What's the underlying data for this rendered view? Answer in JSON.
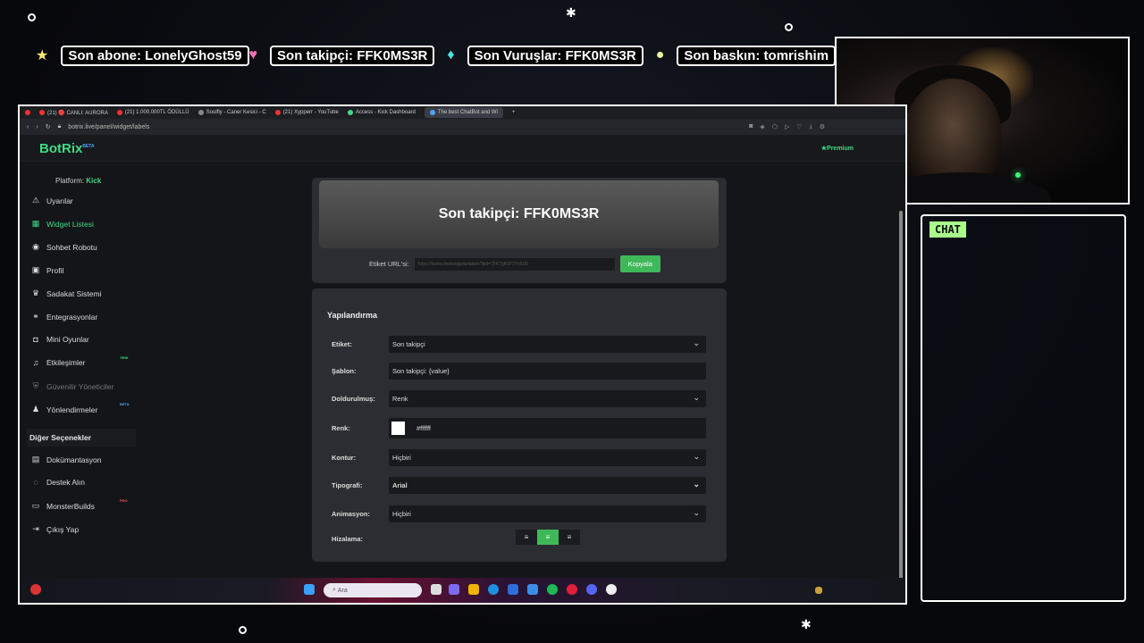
{
  "ticker": [
    {
      "icon": "star-icon",
      "text": "Son abone: LonelyGhost59"
    },
    {
      "icon": "heart-icon",
      "text": "Son takipçi: FFK0MS3R"
    },
    {
      "icon": "diamond-icon",
      "text": "Son Vuruşlar: FFK0MS3R"
    },
    {
      "icon": "moon-icon",
      "text": "Son baskın: tomrishim"
    }
  ],
  "chat": {
    "label": "CHAT"
  },
  "browser": {
    "tabs": [
      "(21) 🔴 CANLI: AURORA",
      "(21) 1.000.000TL ÖDÜLLÜ",
      "Soulfly - Caner Kesici - C",
      "(21) Xypperr - YouTube",
      "Access - Kick Dashboard",
      "The best ChatBot and Wi"
    ],
    "url": "botrix.live/panel/widget/labels"
  },
  "app": {
    "logo": "BotRix",
    "logo_badge": "BETA",
    "premium": "Premium",
    "platform_label": "Platform:",
    "platform_value": "Kick"
  },
  "sidebar": {
    "items": [
      {
        "icon": "warning-icon",
        "label": "Uyarılar"
      },
      {
        "icon": "grid-icon",
        "label": "Widget Listesi"
      },
      {
        "icon": "robot-icon",
        "label": "Sohbet Robotu"
      },
      {
        "icon": "user-icon",
        "label": "Profil"
      },
      {
        "icon": "trophy-icon",
        "label": "Sadakat Sistemi"
      },
      {
        "icon": "plug-icon",
        "label": "Entegrasyonlar"
      },
      {
        "icon": "gamepad-icon",
        "label": "Mini Oyunlar"
      },
      {
        "icon": "music-icon",
        "label": "Etkileşimler"
      },
      {
        "icon": "shield-icon",
        "label": "Güvenilir Yöneticiler"
      },
      {
        "icon": "users-icon",
        "label": "Yönlendirmeler"
      }
    ],
    "badges": {
      "new": "YENİ",
      "beta": "BETA"
    },
    "section_title": "Diğer Seçenekler",
    "other": [
      {
        "icon": "book-icon",
        "label": "Dokümantasyon"
      },
      {
        "icon": "help-icon",
        "label": "Destek Alın"
      },
      {
        "icon": "laptop-icon",
        "label": "MonsterBuilds"
      },
      {
        "icon": "logout-icon",
        "label": "Çıkış Yap"
      }
    ],
    "other_badge": "PRO"
  },
  "preview": {
    "text": "Son takipçi: FFK0MS3R",
    "url_label": "Etiket URL'si:",
    "url_value": "https://botrix.live/widgets/labels?bid=7FK7gK6F1Yn5U0",
    "copy_button": "Kopyala"
  },
  "config": {
    "title": "Yapılandırma",
    "fields": {
      "label": {
        "name": "Etiket:",
        "value": "Son takipçi"
      },
      "template": {
        "name": "Şablon:",
        "value": "Son takipçi: {value}"
      },
      "fill": {
        "name": "Doldurulmuş:",
        "value": "Renk"
      },
      "color": {
        "name": "Renk:",
        "value": "#ffffff"
      },
      "stroke": {
        "name": "Kontur:",
        "value": "Hiçbiri"
      },
      "typography": {
        "name": "Tipografi:",
        "value": "Arial"
      },
      "animation": {
        "name": "Animasyon:",
        "value": "Hiçbiri"
      },
      "alignment": {
        "name": "Hizalama:",
        "selected": "center"
      }
    }
  },
  "taskbar": {
    "search_placeholder": "Ara"
  },
  "colors": {
    "accent": "#3ddc84",
    "copy_button": "#3fb85a",
    "chat_label": "#a8ff8a"
  }
}
